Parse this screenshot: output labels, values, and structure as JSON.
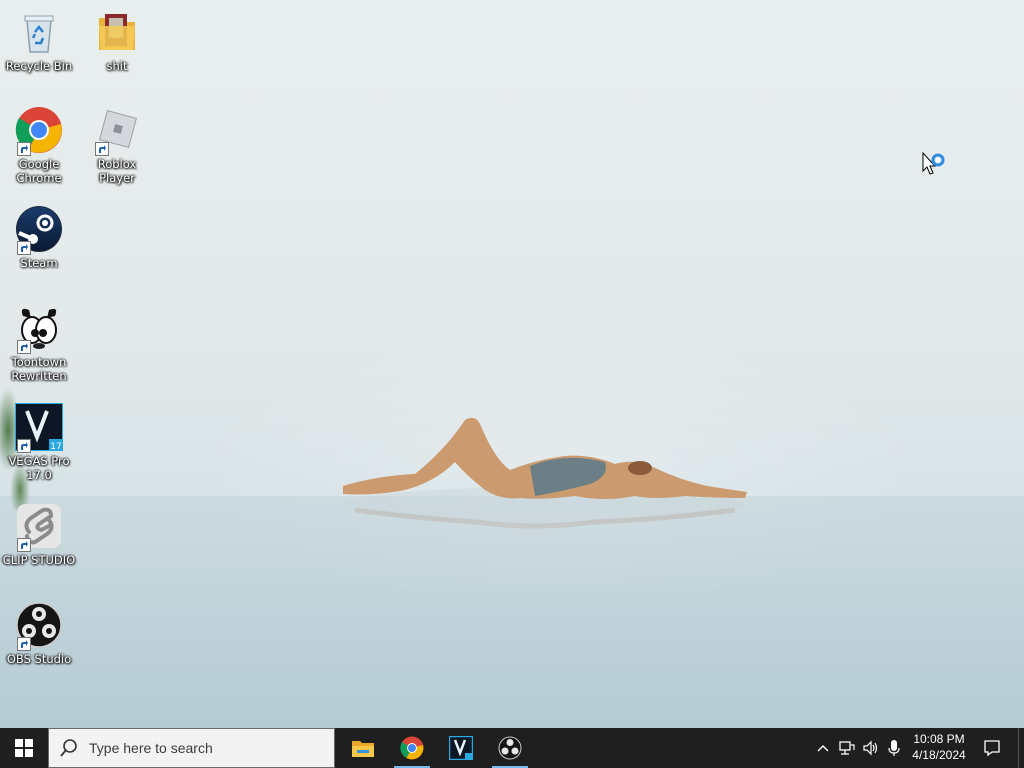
{
  "desktop": {
    "icons": [
      {
        "label": "Recycle Bin",
        "icon": "recycle-bin-icon"
      },
      {
        "label": "shit",
        "icon": "folder-icon"
      },
      {
        "label": "Google Chrome",
        "icon": "chrome-icon"
      },
      {
        "label": "Roblox Player",
        "icon": "roblox-icon"
      },
      {
        "label": "Steam",
        "icon": "steam-icon"
      },
      {
        "label": "Toontown Rewritten",
        "icon": "toontown-icon"
      },
      {
        "label": "VEGAS Pro 17.0",
        "icon": "vegas-pro-icon"
      },
      {
        "label": "CLIP STUDIO",
        "icon": "clip-studio-icon"
      },
      {
        "label": "OBS Studio",
        "icon": "obs-icon"
      }
    ]
  },
  "taskbar": {
    "search_placeholder": "Type here to search",
    "pinned_apps": [
      "file-explorer-icon",
      "chrome-icon",
      "vegas-pro-icon",
      "obs-icon"
    ],
    "tray_icons": [
      "chevron-up-icon",
      "network-icon",
      "volume-icon",
      "microphone-icon"
    ],
    "time": "10:08 PM",
    "date": "4/18/2024"
  },
  "colors": {
    "taskbar_bg": "#1f1f1f",
    "accent": "#76b9ed"
  }
}
